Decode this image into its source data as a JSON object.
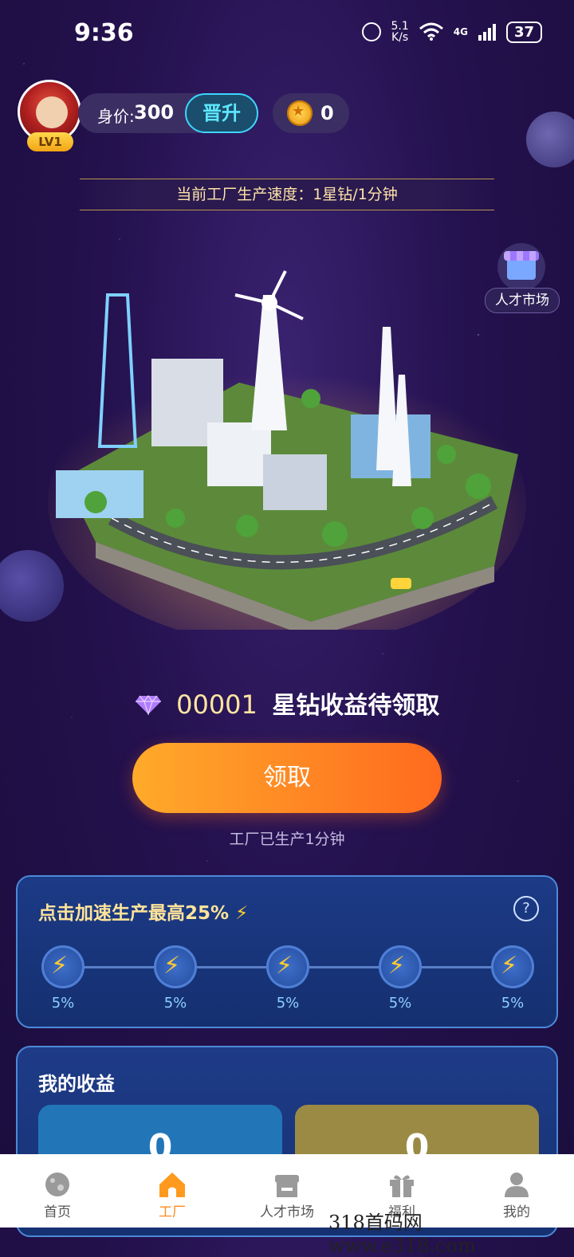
{
  "status_bar": {
    "time": "9:36",
    "network_speed_value": "5.1",
    "network_speed_unit": "K/s",
    "cell_type": "4G",
    "battery": "37"
  },
  "header": {
    "level": "LV1",
    "worth_label": "身价:",
    "worth_value": "300",
    "promote_label": "晋升",
    "coin_count": "0"
  },
  "speed_text": "当前工厂生产速度：1星钻/1分钟",
  "talent_market_label": "人才市场",
  "claim": {
    "diamond_count": "00001",
    "pending_text": "星钻收益待领取",
    "button_label": "领取",
    "produced_text": "工厂已生产1分钟"
  },
  "boost": {
    "title": "点击加速生产最高25%",
    "nodes": [
      {
        "percent": "5%"
      },
      {
        "percent": "5%"
      },
      {
        "percent": "5%"
      },
      {
        "percent": "5%"
      },
      {
        "percent": "5%"
      }
    ]
  },
  "earnings": {
    "title": "我的收益",
    "values": [
      "0",
      "0"
    ]
  },
  "tabbar": {
    "items": [
      {
        "label": "首页",
        "icon": "planet-icon"
      },
      {
        "label": "工厂",
        "icon": "home-icon"
      },
      {
        "label": "人才市场",
        "icon": "store-icon"
      },
      {
        "label": "福利",
        "icon": "gift-icon"
      },
      {
        "label": "我的",
        "icon": "user-icon"
      }
    ],
    "active_index": 1
  },
  "watermark": "318首码网  www.e318.com",
  "colors": {
    "background": "#24114e",
    "accent_orange": "#ff8a1e",
    "accent_cyan": "#3ed6ff",
    "gold": "#ffe4a8"
  }
}
